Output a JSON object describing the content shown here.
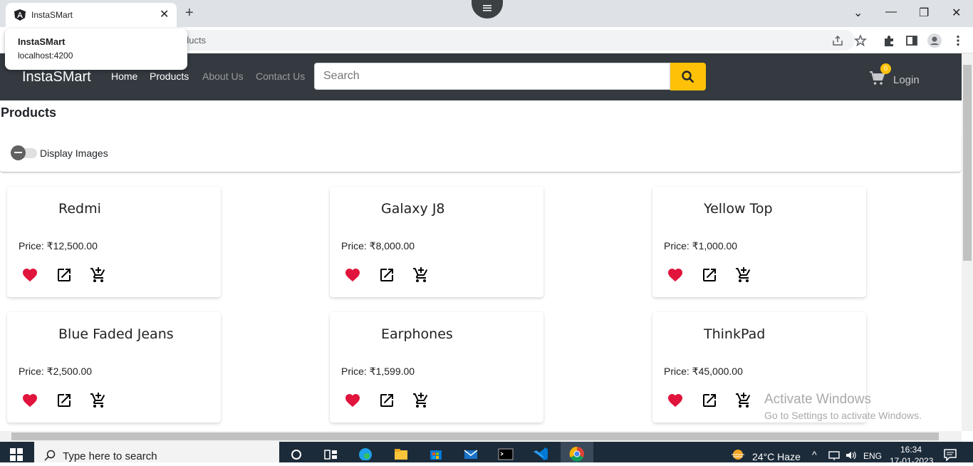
{
  "browser": {
    "tab_title": "InstaSMart",
    "new_tab": "+",
    "close_tab": "✕",
    "url_fragment": "ducts",
    "hover_card": {
      "title": "InstaSMart",
      "url": "localhost:4200"
    },
    "window_controls": {
      "dropdown": "⌄",
      "minimize": "—",
      "restore": "❐",
      "close": "✕"
    }
  },
  "navbar": {
    "brand": "InstaSMart",
    "links": [
      {
        "label": "Home",
        "active": true
      },
      {
        "label": "Products",
        "active": true
      },
      {
        "label": "About Us",
        "active": false
      },
      {
        "label": "Contact Us",
        "active": false
      }
    ],
    "search_placeholder": "Search",
    "cart_count": "0",
    "login": "Login"
  },
  "page": {
    "title": "Products",
    "toggle_label": "Display Images"
  },
  "products": [
    {
      "name": "Redmi",
      "price": "Price: ₹12,500.00"
    },
    {
      "name": "Galaxy J8",
      "price": "Price: ₹8,000.00"
    },
    {
      "name": "Yellow Top",
      "price": "Price: ₹1,000.00"
    },
    {
      "name": "Blue Faded Jeans",
      "price": "Price: ₹2,500.00"
    },
    {
      "name": "Earphones",
      "price": "Price: ₹1,599.00"
    },
    {
      "name": "ThinkPad",
      "price": "Price: ₹45,000.00"
    }
  ],
  "watermark": {
    "line1": "Activate Windows",
    "line2": "Go to Settings to activate Windows."
  },
  "taskbar": {
    "search_text": "Type here to search",
    "weather": "24°C  Haze",
    "language": "ENG",
    "time": "16:34",
    "date": "17-01-2023"
  },
  "colors": {
    "navbar": "#343a40",
    "accent": "#ffc107",
    "heart": "#e0143c"
  }
}
